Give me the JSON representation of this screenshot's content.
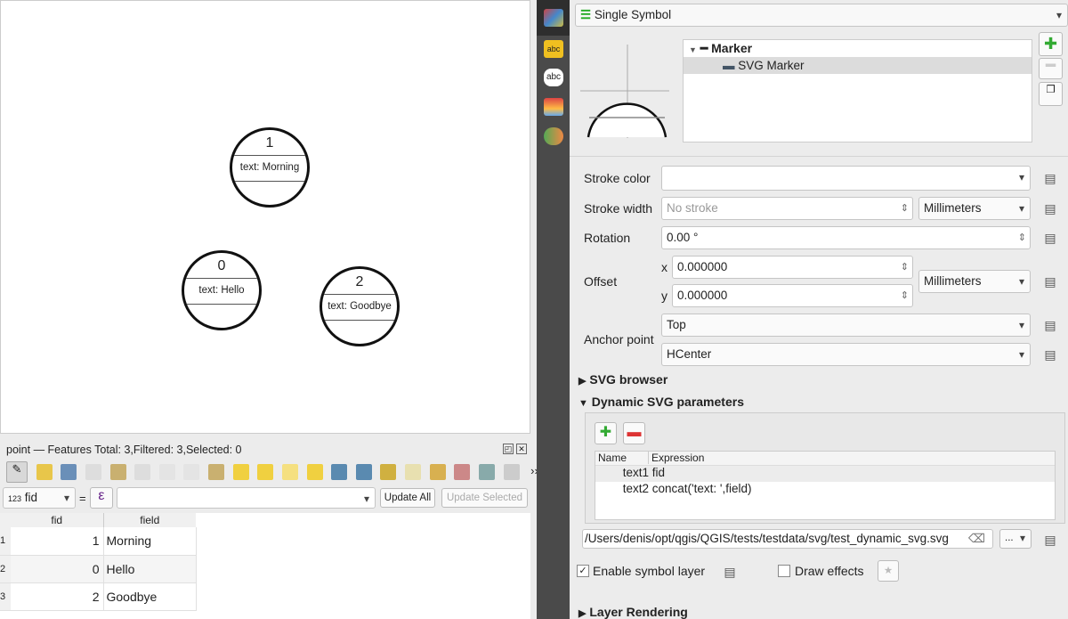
{
  "map": {
    "features": [
      {
        "fid": "1",
        "label": "text: Morning"
      },
      {
        "fid": "0",
        "label": "text: Hello"
      },
      {
        "fid": "2",
        "label": "text: Goodbye"
      }
    ]
  },
  "attribute_table": {
    "title": "point — Features Total: 3,Filtered: 3,Selected: 0",
    "field_selector": "fid",
    "field_type": "123",
    "equals": "=",
    "expression_icon": "ε",
    "update_all": "Update All",
    "update_selected": "Update Selected",
    "more": "››",
    "columns": [
      "fid",
      "field"
    ],
    "rows": [
      {
        "n": "1",
        "fid": "1",
        "field": "Morning"
      },
      {
        "n": "2",
        "fid": "0",
        "field": "Hello"
      },
      {
        "n": "3",
        "fid": "2",
        "field": "Goodbye"
      }
    ]
  },
  "symbology": {
    "renderer": "Single Symbol",
    "tree": {
      "marker": "Marker",
      "svg_marker": "SVG Marker"
    },
    "stroke_color_label": "Stroke color",
    "stroke_width_label": "Stroke width",
    "stroke_width_placeholder": "No stroke",
    "stroke_width_unit": "Millimeters",
    "rotation_label": "Rotation",
    "rotation_value": "0.00 °",
    "offset_label": "Offset",
    "offset_x_label": "x",
    "offset_x": "0.000000",
    "offset_y_label": "y",
    "offset_y": "0.000000",
    "offset_unit": "Millimeters",
    "anchor_label": "Anchor point",
    "anchor_v": "Top",
    "anchor_h": "HCenter",
    "svg_browser": "SVG browser",
    "dynamic_params": "Dynamic SVG parameters",
    "params_columns": [
      "Name",
      "Expression"
    ],
    "params": [
      {
        "name": "text1",
        "expr": "fid"
      },
      {
        "name": "text2",
        "expr": "concat('text: ',field)"
      }
    ],
    "svg_path": "/Users/denis/opt/qgis/QGIS/tests/testdata/svg/test_dynamic_svg.svg",
    "browse": "...",
    "enable_layer": "Enable symbol layer",
    "draw_effects": "Draw effects",
    "layer_rendering": "Layer Rendering"
  }
}
